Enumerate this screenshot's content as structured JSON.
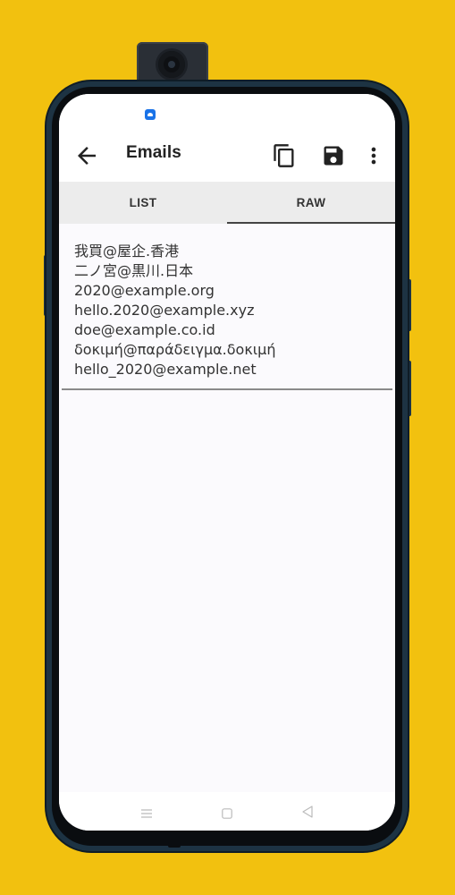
{
  "app_bar": {
    "title": "Emails",
    "back_icon": "arrow-back-icon",
    "actions": [
      "copy-icon",
      "save-icon",
      "more-vert-icon"
    ]
  },
  "tabs": [
    {
      "label": "LIST",
      "selected": false
    },
    {
      "label": "RAW",
      "selected": true
    }
  ],
  "raw_text": {
    "lines": [
      "我買@屋企.香港",
      "二ノ宮@黒川.日本",
      "2020@example.org",
      "hello.2020@example.xyz",
      "doe@example.co.id",
      "δοκιμή@παράδειγμα.δοκιμή",
      "hello_2020@example.net"
    ]
  },
  "nav_bar": {
    "icons": [
      "menu-icon",
      "home-square-icon",
      "back-triangle-icon"
    ]
  },
  "colors": {
    "background": "#f2c10f",
    "accent_indicator": "#444444",
    "tab_bar": "#ececec",
    "status_icon": "#1a73e8"
  }
}
